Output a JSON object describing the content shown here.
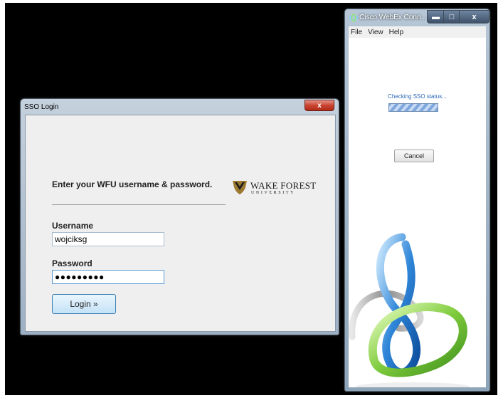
{
  "webex": {
    "title": "Cisco WebEx Conn...",
    "menu": [
      "File",
      "View",
      "Help"
    ],
    "status": "Checking SSO status...",
    "cancel_label": "Cancel",
    "controls": {
      "min": "▬",
      "max": "□",
      "close": "x"
    }
  },
  "sso": {
    "title": "SSO Login",
    "close_glyph": "x",
    "heading": "Enter your WFU username & password.",
    "logo_text": "WAKE FOREST",
    "logo_sub": "UNIVERSITY",
    "username_label": "Username",
    "username_value": "wojciksg",
    "password_label": "Password",
    "password_value": "●●●●●●●●●",
    "login_label": "Login »"
  },
  "colors": {
    "accent": "#2a67b6",
    "close_red": "#c94431",
    "login_border": "#3c7fb1"
  }
}
